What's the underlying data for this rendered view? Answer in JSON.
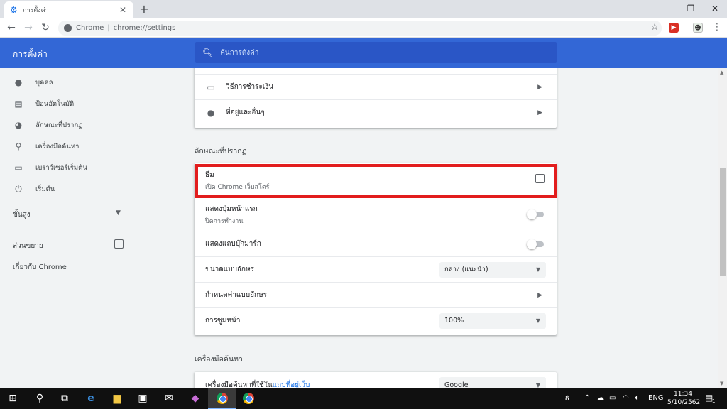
{
  "browser": {
    "tab_title": "การตั้งค่า",
    "omnibox_host": "Chrome",
    "omnibox_separator": "|",
    "omnibox_url": "chrome://settings"
  },
  "header": {
    "title": "การตั้งค่า",
    "search_placeholder": "ค้นการตั้งค่า"
  },
  "sidebar": {
    "items": [
      {
        "label": "บุคคล",
        "icon": "person-icon"
      },
      {
        "label": "ป้อนอัตโนมัติ",
        "icon": "clipboard-icon"
      },
      {
        "label": "ลักษณะที่ปรากฏ",
        "icon": "palette-icon"
      },
      {
        "label": "เครื่องมือค้นหา",
        "icon": "search-icon"
      },
      {
        "label": "เบราว์เซอร์เริ่มต้น",
        "icon": "browser-icon"
      },
      {
        "label": "เริ่มต้น",
        "icon": "power-icon"
      }
    ],
    "advanced": "ขั้นสูง",
    "extensions": "ส่วนขยาย",
    "about": "เกี่ยวกับ Chrome"
  },
  "autofill_card": {
    "payment": "วิธีการชำระเงิน",
    "addresses": "ที่อยู่และอื่นๆ"
  },
  "appearance": {
    "section_title": "ลักษณะที่ปรากฏ",
    "theme_title": "ธีม",
    "theme_sub": "เปิด Chrome เว็บสโตร์",
    "home_button": "แสดงปุ่มหน้าแรก",
    "home_button_sub": "ปิดการทำงาน",
    "bookmarks_bar": "แสดงแถบบุ๊กมาร์ก",
    "font_size": "ขนาดแบบอักษร",
    "font_size_value": "กลาง (แนะนำ)",
    "customize_fonts": "กำหนดค่าแบบอักษร",
    "page_zoom": "การซูมหน้า",
    "page_zoom_value": "100%"
  },
  "search_engine": {
    "section_title": "เครื่องมือค้นหา",
    "row_prefix": "เครื่องมือค้นหาที่ใช้ใน",
    "row_link": "แถบที่อยู่เว็บ",
    "value": "Google"
  },
  "taskbar": {
    "language": "ENG",
    "time": "11:34",
    "date": "5/10/2562",
    "notification_count": "1"
  },
  "colors": {
    "header_blue": "#3367d6",
    "highlight_red": "#e21d1d"
  }
}
